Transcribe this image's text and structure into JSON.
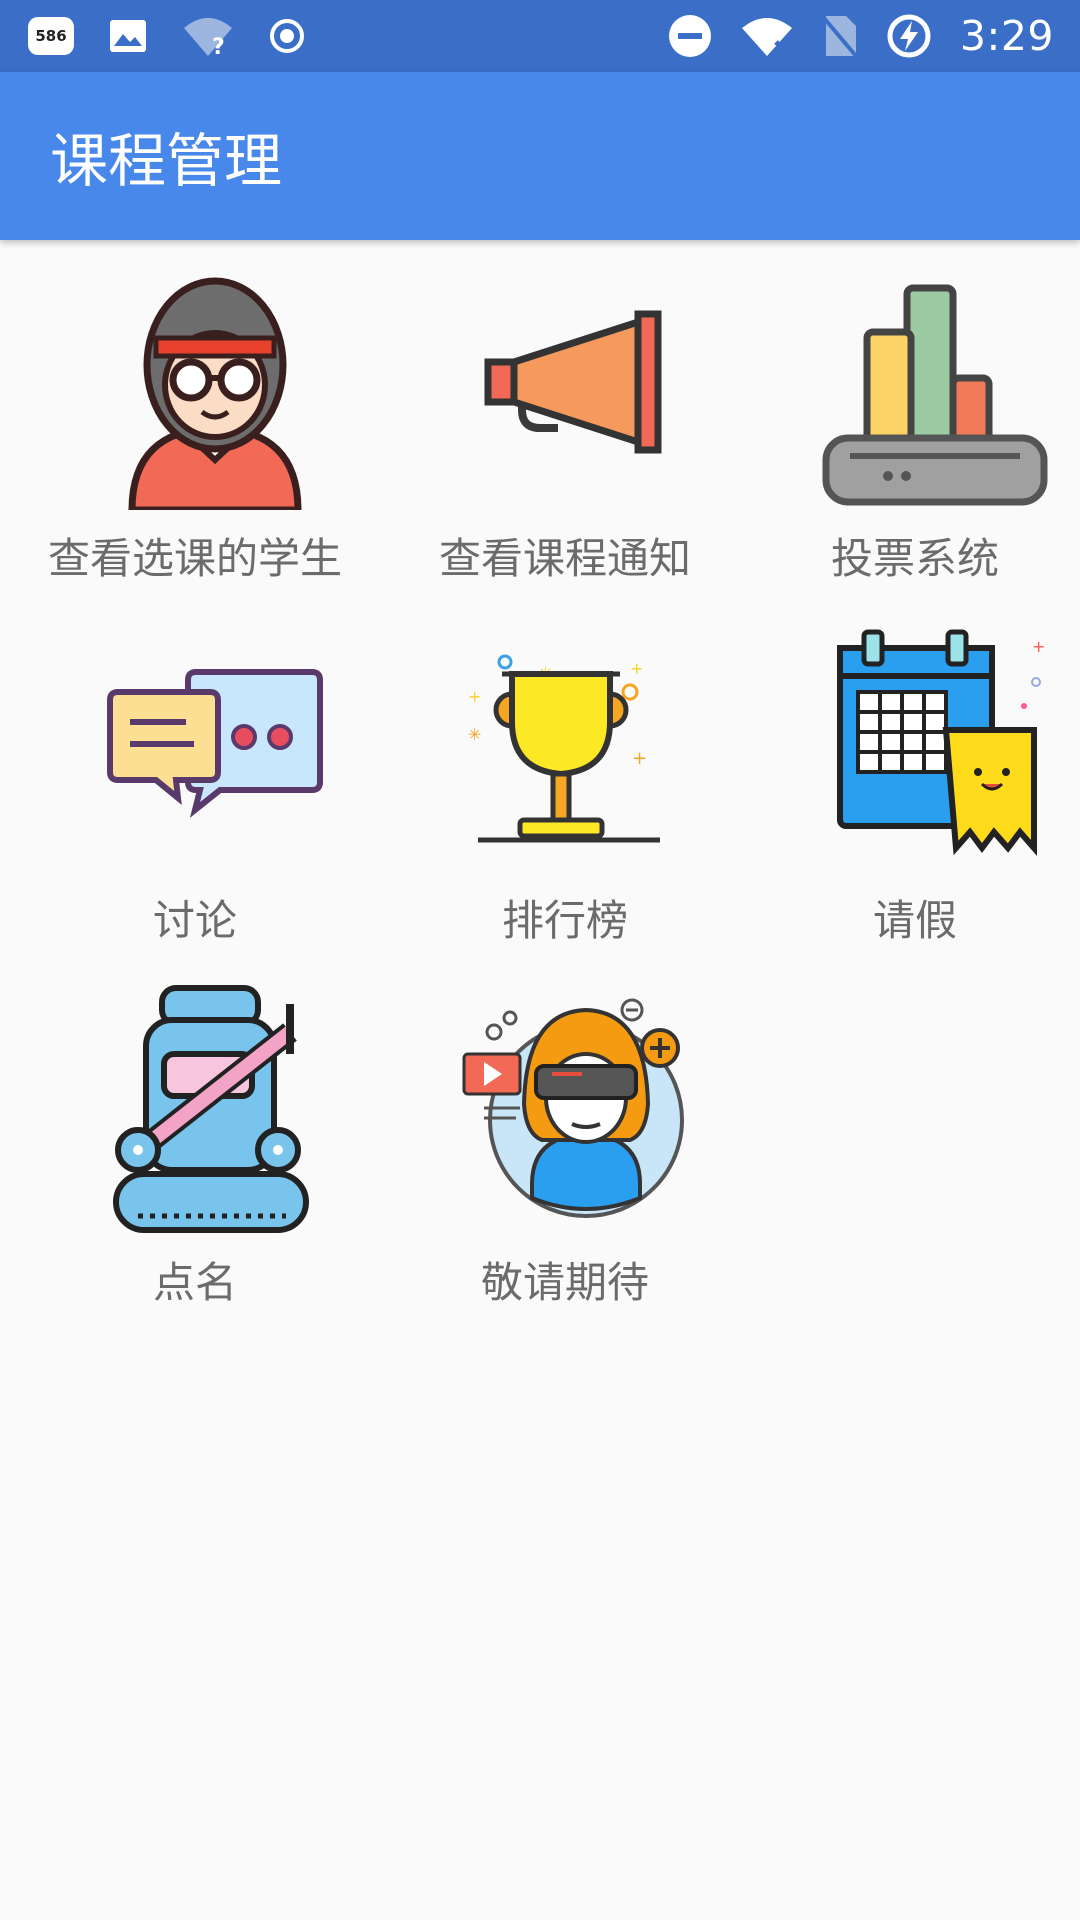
{
  "status_bar": {
    "notification_badge": "586",
    "time": "3:29",
    "icons": [
      "notification-badge-icon",
      "image-icon",
      "wifi-question-icon",
      "target-icon",
      "do-not-disturb-icon",
      "wifi-off-icon",
      "no-sim-icon",
      "battery-charging-icon"
    ]
  },
  "app_bar": {
    "title": "课程管理"
  },
  "menu": {
    "items": [
      {
        "label": "查看选课的学生",
        "icon": "student-icon"
      },
      {
        "label": "查看课程通知",
        "icon": "megaphone-icon"
      },
      {
        "label": "投票系统",
        "icon": "bar-chart-icon"
      },
      {
        "label": "讨论",
        "icon": "chat-bubbles-icon"
      },
      {
        "label": "排行榜",
        "icon": "trophy-icon"
      },
      {
        "label": "请假",
        "icon": "calendar-icon"
      },
      {
        "label": "点名",
        "icon": "robot-icon"
      },
      {
        "label": "敬请期待",
        "icon": "vr-person-icon"
      }
    ]
  },
  "colors": {
    "status_bar": "#3b6fc7",
    "app_bar": "#4788ea",
    "background": "#fafafa",
    "label_text": "#6b6b6b"
  }
}
